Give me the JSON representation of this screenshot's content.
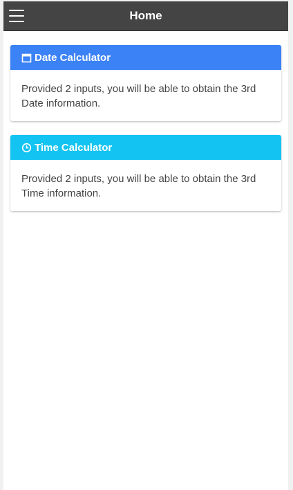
{
  "header": {
    "title": "Home"
  },
  "colors": {
    "topbar": "#444444",
    "date_card_accent": "#3b82f6",
    "time_card_accent": "#13c4f2"
  },
  "cards": [
    {
      "icon": "calendar-icon",
      "title": "Date Calculator",
      "description": "Provided 2 inputs, you will be able to obtain the 3rd Date information."
    },
    {
      "icon": "clock-icon",
      "title": "Time Calculator",
      "description": "Provided 2 inputs, you will be able to obtain the 3rd Time information."
    }
  ]
}
